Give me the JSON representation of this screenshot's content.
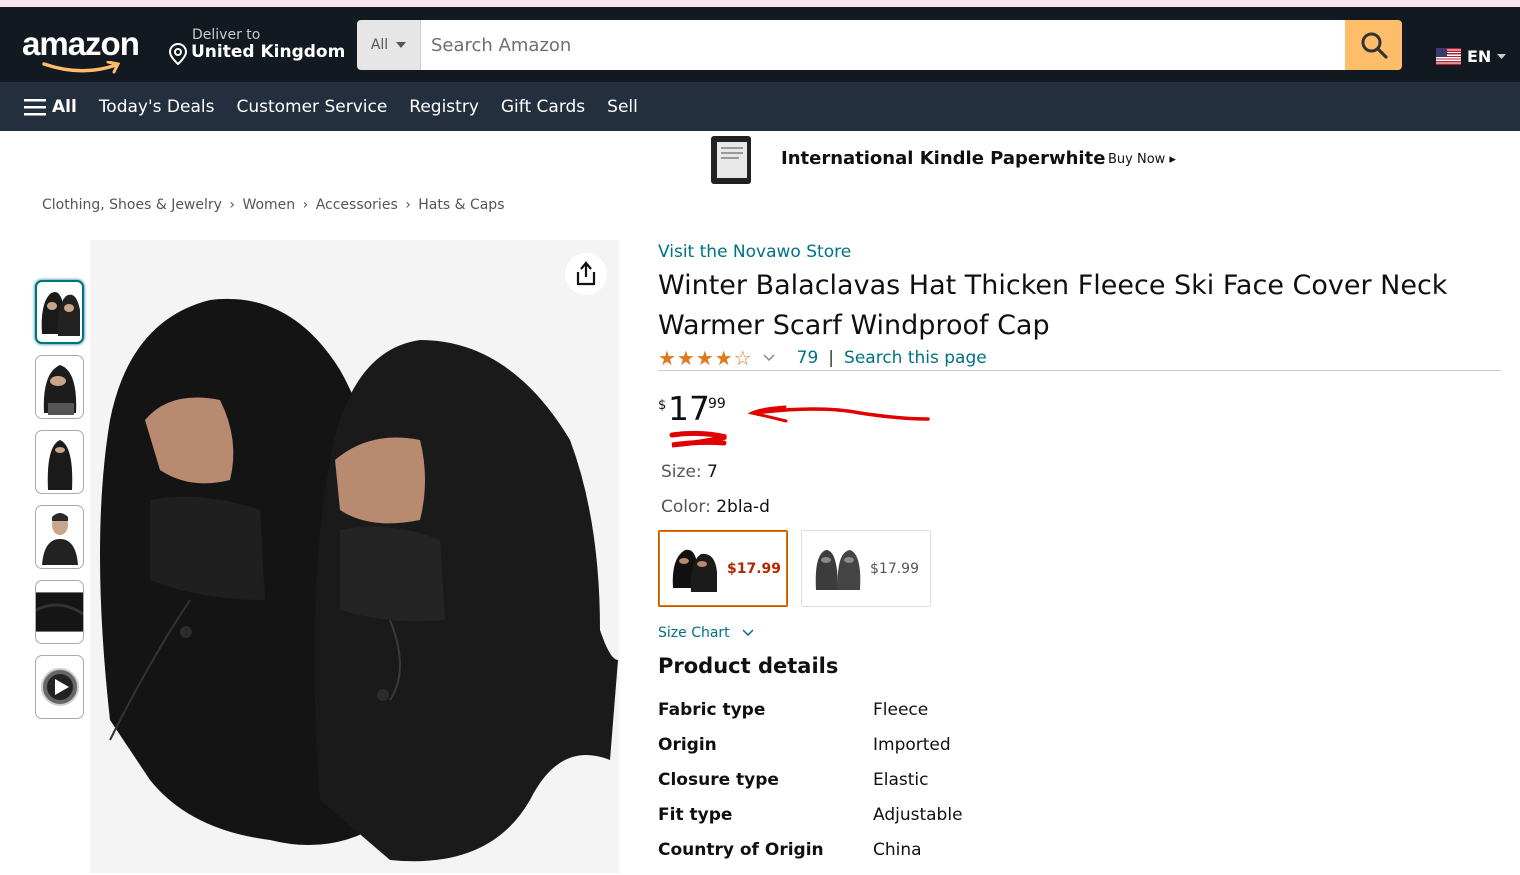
{
  "header": {
    "logo": "amazon",
    "deliver_line1": "Deliver to",
    "deliver_line2": "United Kingdom",
    "search_category": "All",
    "search_placeholder": "Search Amazon",
    "language": "EN"
  },
  "subnav": {
    "all": "All",
    "items": [
      "Today's Deals",
      "Customer Service",
      "Registry",
      "Gift Cards",
      "Sell"
    ]
  },
  "banner": {
    "title": "International Kindle Paperwhite",
    "cta": "Buy Now ▸"
  },
  "breadcrumbs": [
    "Clothing, Shoes & Jewelry",
    "›",
    "Women",
    "›",
    "Accessories",
    "›",
    "Hats & Caps"
  ],
  "product": {
    "store_link": "Visit the Novawo Store",
    "title": "Winter Balaclavas Hat Thicken Fleece Ski Face Cover Neck Warmer Scarf Windproof Cap",
    "rating_stars": 4,
    "stars_text": "★★★★☆",
    "rating_count": "79",
    "separator": "|",
    "search_page": "Search this page",
    "price_currency": "$",
    "price_whole": "17",
    "price_fraction": "99",
    "size_label": "Size:",
    "size_value": "7",
    "color_label": "Color:",
    "color_value": "2bla-d",
    "swatches": [
      {
        "price": "$17.99"
      },
      {
        "price": "$17.99"
      }
    ],
    "size_chart": "Size Chart"
  },
  "details": {
    "title": "Product details",
    "rows": [
      {
        "k": "Fabric type",
        "v": "Fleece"
      },
      {
        "k": "Origin",
        "v": "Imported"
      },
      {
        "k": "Closure type",
        "v": "Elastic"
      },
      {
        "k": "Fit type",
        "v": "Adjustable"
      },
      {
        "k": "Country of Origin",
        "v": "China"
      }
    ]
  },
  "colors": {
    "nav_dark": "#131921",
    "nav_secondary": "#232f3e",
    "search_button": "#febd69",
    "link": "#007185",
    "star": "#de7921",
    "price_red": "#b12704",
    "annotation_red": "#e00000"
  }
}
